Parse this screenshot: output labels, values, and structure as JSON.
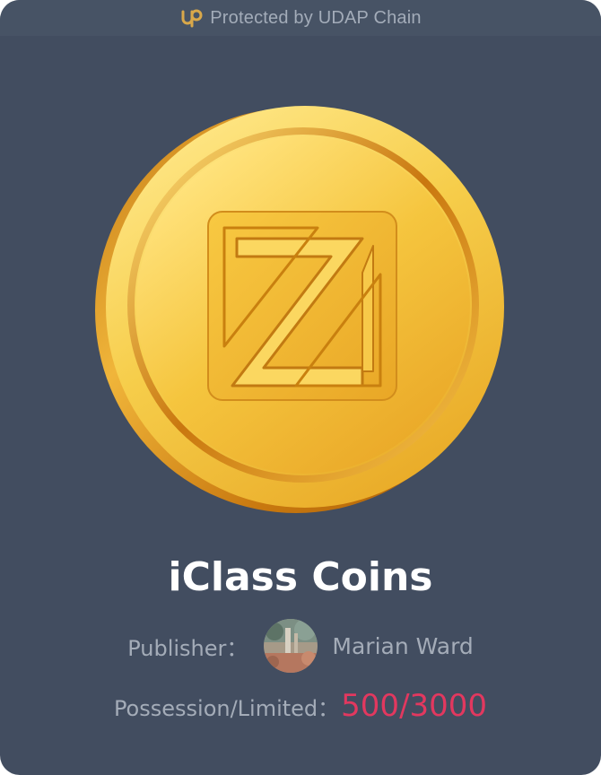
{
  "banner": {
    "icon": "udap-chain-icon",
    "text": "Protected by UDAP Chain"
  },
  "coin": {
    "icon": "z-coin-icon"
  },
  "title": "iClass Coins",
  "publisher": {
    "label": "Publisher：",
    "name": "Marian Ward",
    "avatar_icon": "avatar"
  },
  "possession": {
    "label": "Possession/Limited：",
    "value": "500/3000"
  },
  "colors": {
    "card_bg": "#424d60",
    "accent": "#e2385f",
    "gold": "#f2c23a"
  }
}
